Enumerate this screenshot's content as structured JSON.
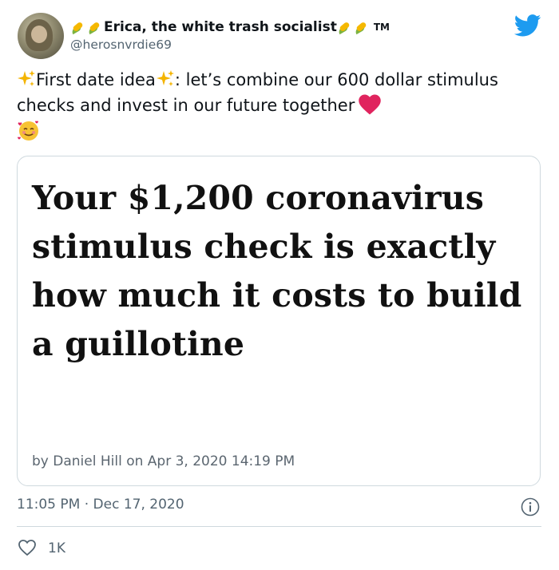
{
  "author": {
    "display_name": "Erica, the white trash socialist",
    "trademark": "TM",
    "handle": "@herosnvrdie69"
  },
  "tweet": {
    "text_part1": "First date idea",
    "text_part2": ": let’s combine our 600 dollar stimulus checks and invest in our future together",
    "card": {
      "headline": "Your $1,200 coronavirus stimulus check is exactly how much it costs to build a guillotine",
      "byline": "by Daniel Hill on Apr 3, 2020 14:19 PM"
    },
    "timestamp": "11:05 PM · Dec 17, 2020",
    "likes": "1K"
  },
  "colors": {
    "twitter_blue": "#1d9bf0",
    "heart_red": "#e0245e",
    "secondary_text": "#536471"
  },
  "icons": [
    "corn-emoji-icon",
    "twitter-bird-icon",
    "sparkles-icon",
    "red-heart-icon",
    "smiling-face-with-hearts-icon",
    "info-icon",
    "like-heart-icon"
  ]
}
